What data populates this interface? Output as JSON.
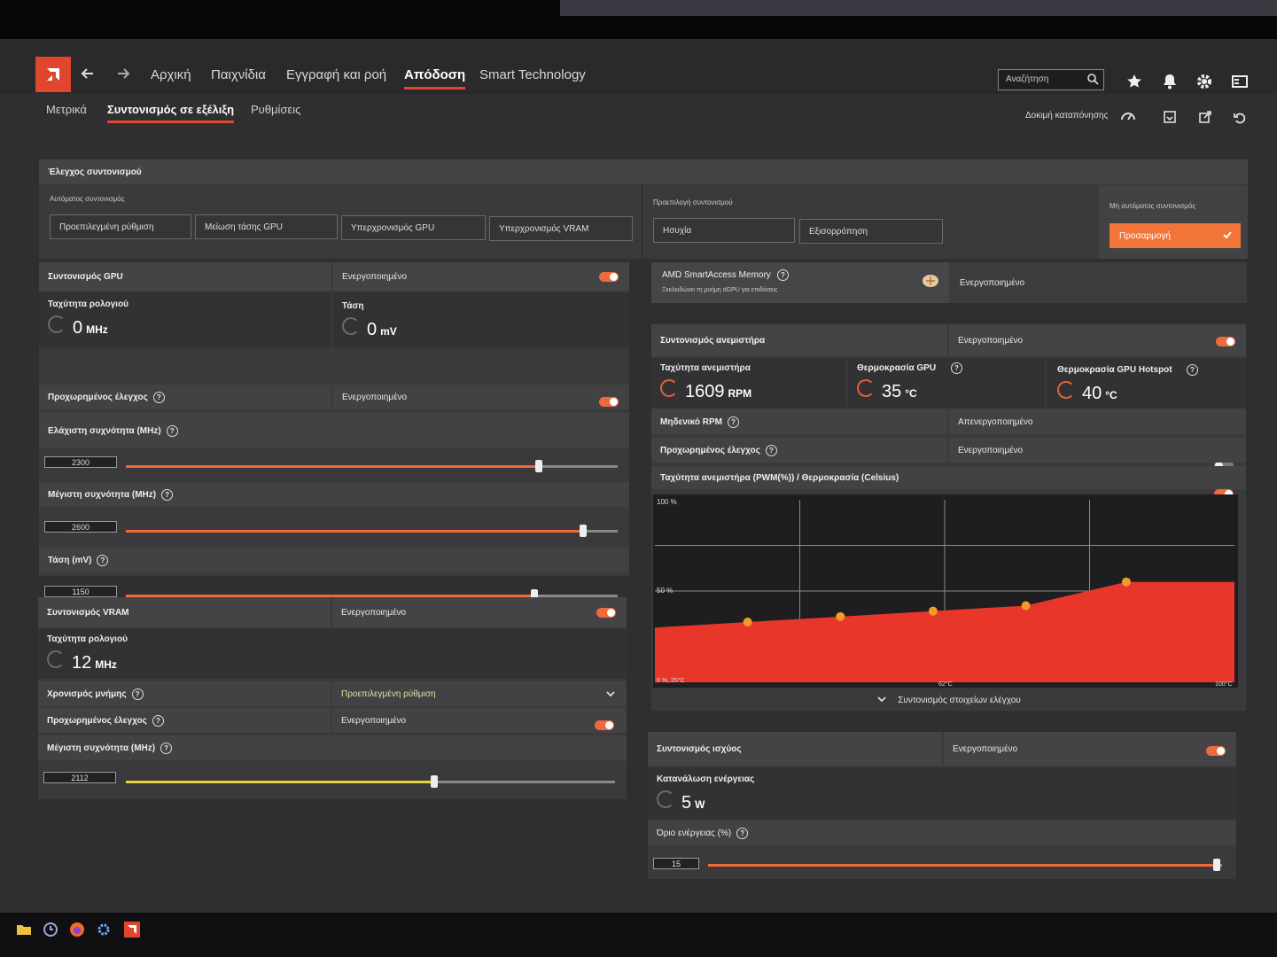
{
  "nav": {
    "items": [
      "Αρχική",
      "Παιχνίδια",
      "Εγγραφή και ροή",
      "Απόδοση",
      "Smart Technology"
    ],
    "search_placeholder": "Αναζήτηση"
  },
  "subnav": {
    "items": [
      "Μετρικά",
      "Συντονισμός σε εξέλιξη",
      "Ρυθμίσεις"
    ],
    "stress_test": "Δοκιμή καταπόνησης"
  },
  "tuning_control": {
    "title": "Έλεγχος συντονισμού",
    "auto_label": "Αυτόματος συντονισμός",
    "auto_buttons": [
      "Προεπιλεγμένη ρύθμιση",
      "Μείωση τάσης GPU",
      "Υπερχρονισμός GPU",
      "Υπερχρονισμός VRAM"
    ],
    "preset_label": "Προεπιλογή συντονισμού",
    "preset_buttons": [
      "Ησυχία",
      "Εξισορρόπηση"
    ],
    "manual_label": "Μη αυτόματος συντονισμός",
    "manual_button": "Προσαρμογή"
  },
  "gpu": {
    "title": "Συντονισμός GPU",
    "state": "Ενεργοποιημένο",
    "clock_label": "Ταχύτητα ρολογιού",
    "clock_value": "0",
    "clock_unit": "MHz",
    "voltage_label": "Τάση",
    "voltage_value": "0",
    "voltage_unit": "mV",
    "advanced_label": "Προχωρημένος έλεγχος",
    "advanced_state": "Ενεργοποιημένο",
    "min_freq_label": "Ελάχιστη συχνότητα (MHz)",
    "min_freq_value": "2300",
    "min_freq_level": 0.84,
    "max_freq_label": "Μέγιστη συχνότητα (MHz)",
    "max_freq_value": "2600",
    "max_freq_level": 0.93,
    "volt_label": "Τάση (mV)",
    "volt_value": "1150",
    "volt_level": 0.83
  },
  "vram": {
    "title": "Συντονισμός VRAM",
    "state": "Ενεργοποιημένο",
    "clock_label": "Ταχύτητα ρολογιού",
    "clock_value": "12",
    "clock_unit": "MHz",
    "timing_label": "Χρονισμός μνήμης",
    "timing_value": "Προεπιλεγμένη ρύθμιση",
    "advanced_label": "Προχωρημένος έλεγχος",
    "advanced_state": "Ενεργοποιημένο",
    "max_freq_label": "Μέγιστη συχνότητα (MHz)",
    "max_freq_value": "2112",
    "max_freq_level": 0.63
  },
  "sam": {
    "title": "AMD SmartAccess Memory",
    "desc": "Ξεκλειδώνει τη μνήμη dGPU για επιδόσεις",
    "state": "Ενεργοποιημένο"
  },
  "fan": {
    "title": "Συντονισμός ανεμιστήρα",
    "state": "Ενεργοποιημένο",
    "speed_label": "Ταχύτητα ανεμιστήρα",
    "speed_value": "1609",
    "speed_unit": "RPM",
    "gpu_temp_label": "Θερμοκρασία GPU",
    "gpu_temp_value": "35",
    "temp_unit": "°C",
    "hotspot_label": "Θερμοκρασία GPU Hotspot",
    "hotspot_value": "40",
    "zero_rpm_label": "Μηδενικό RPM",
    "zero_rpm_state": "Απενεργοποιημένο",
    "advanced_label": "Προχωρημένος έλεγχος",
    "advanced_state": "Ενεργοποιημένο",
    "curve_title": "Ταχύτητα ανεμιστήρα (PWM(%)) / Θερμοκρασία (Celsius)",
    "y_top": "100 %",
    "y_mid": "50 %",
    "x_origin": "0 %, 25°C",
    "x_mid": "62°C",
    "x_end": "100°C",
    "expand_label": "Συντονισμός στοιχείων ελέγχου"
  },
  "chart_data": {
    "type": "area",
    "x": [
      25,
      37,
      49,
      61,
      73,
      86,
      100
    ],
    "values": [
      30,
      33,
      36,
      39,
      42,
      55,
      55
    ],
    "xlim": [
      25,
      100
    ],
    "ylim": [
      0,
      100
    ],
    "color": "#e8372a"
  },
  "power": {
    "title": "Συντονισμός ισχύος",
    "state": "Ενεργοποιημένο",
    "consumption_label": "Κατανάλωση ενέργειας",
    "consumption_value": "5",
    "consumption_unit": "W",
    "limit_label": "Όριο ενέργειας (%)",
    "limit_value": "15",
    "limit_level": 0.99
  }
}
